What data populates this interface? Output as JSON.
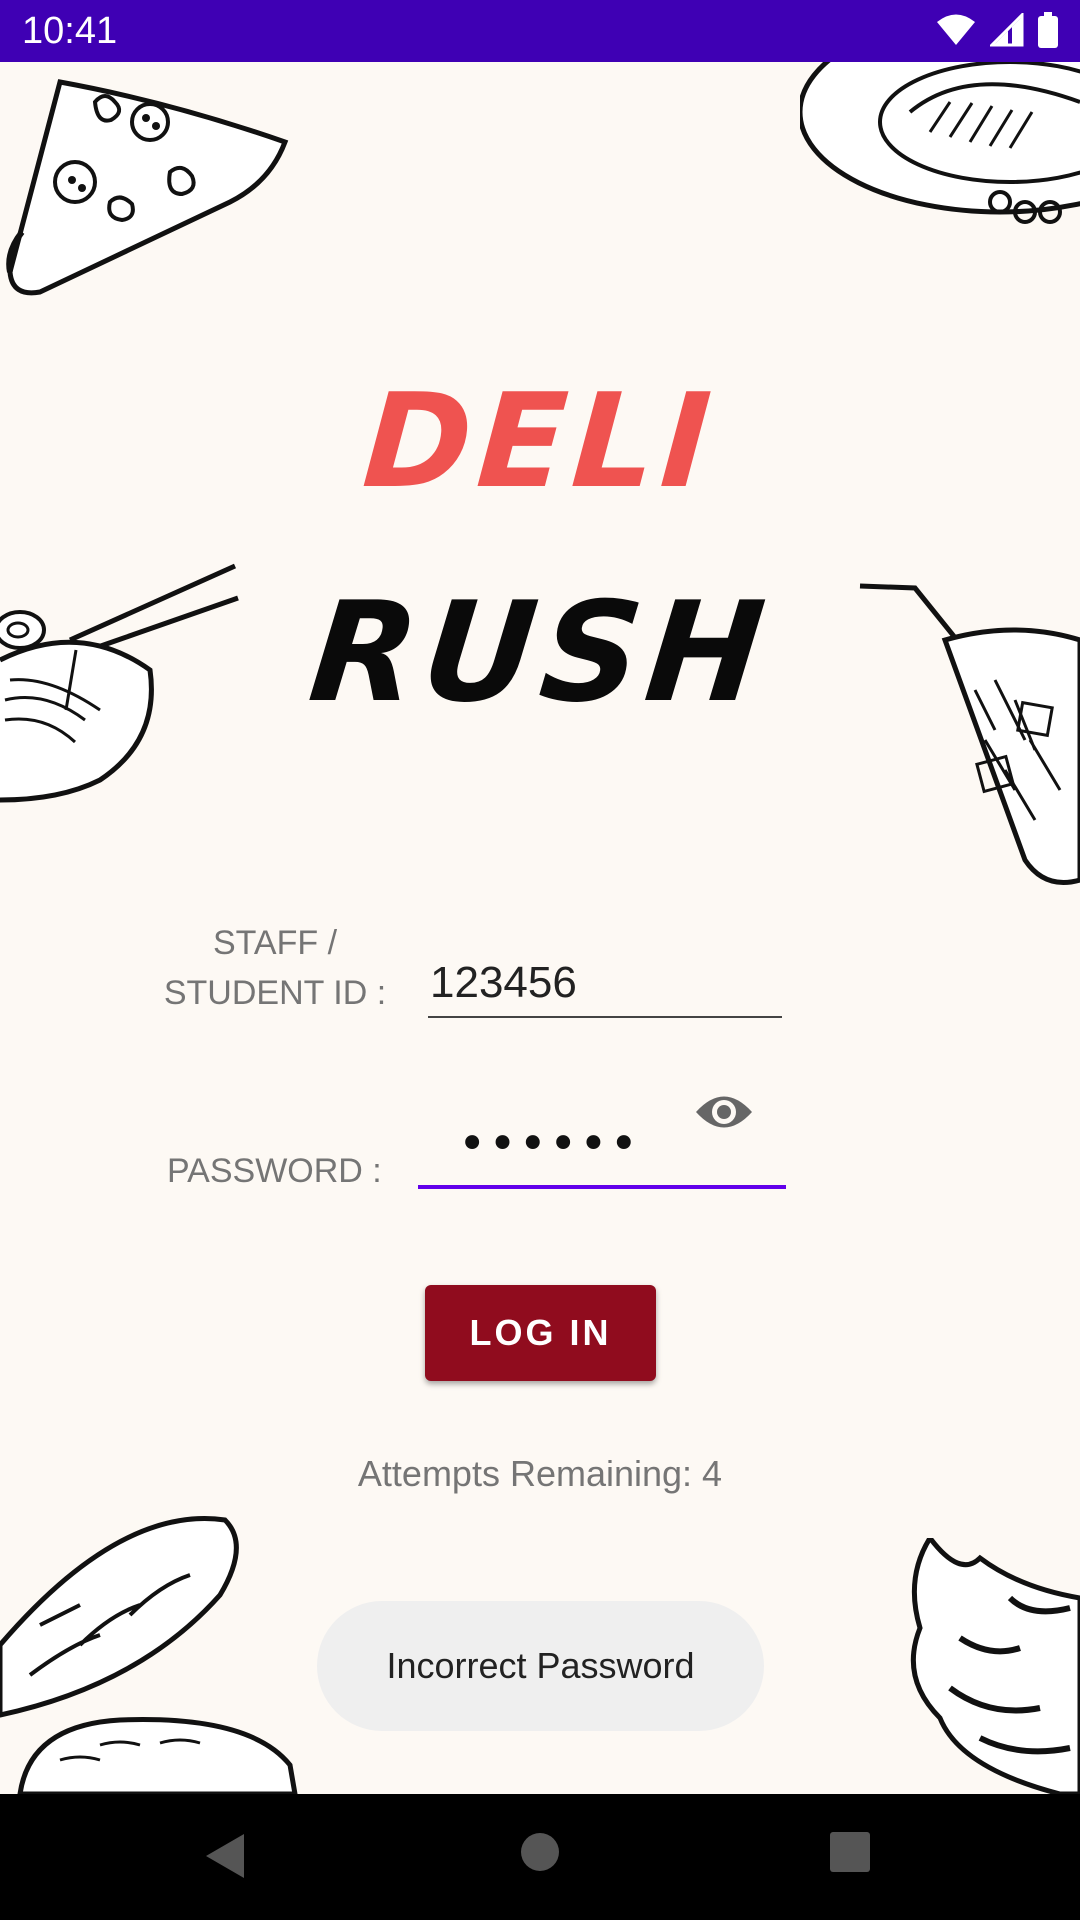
{
  "status_bar": {
    "time": "10:41",
    "icons": [
      "wifi-icon",
      "signal-icon",
      "battery-icon"
    ]
  },
  "app": {
    "title_line1": "DELI",
    "title_line2": "RUSH",
    "title_colors": {
      "line1": "#ef5350",
      "line2": "#0a0a0a"
    }
  },
  "form": {
    "id_label": "STAFF / STUDENT ID :",
    "id_value": "123456",
    "password_label": "PASSWORD :",
    "password_value": "••••••",
    "password_toggle_icon": "eye-icon",
    "login_label": "LOG IN",
    "attempts_text": "Attempts Remaining: 4"
  },
  "toast": {
    "message": "Incorrect Password"
  },
  "nav_bar": {
    "buttons": [
      "back-icon",
      "home-icon",
      "recents-icon"
    ]
  },
  "colors": {
    "status_bar": "#3f00b4",
    "background": "#fdf9f4",
    "login_button": "#900c1e",
    "focus_underline": "#6200ea"
  },
  "decorations": [
    "pizza-slice",
    "burger-plate",
    "ramen-bowl",
    "soda-glass",
    "bread-loaves",
    "ice-cream"
  ]
}
